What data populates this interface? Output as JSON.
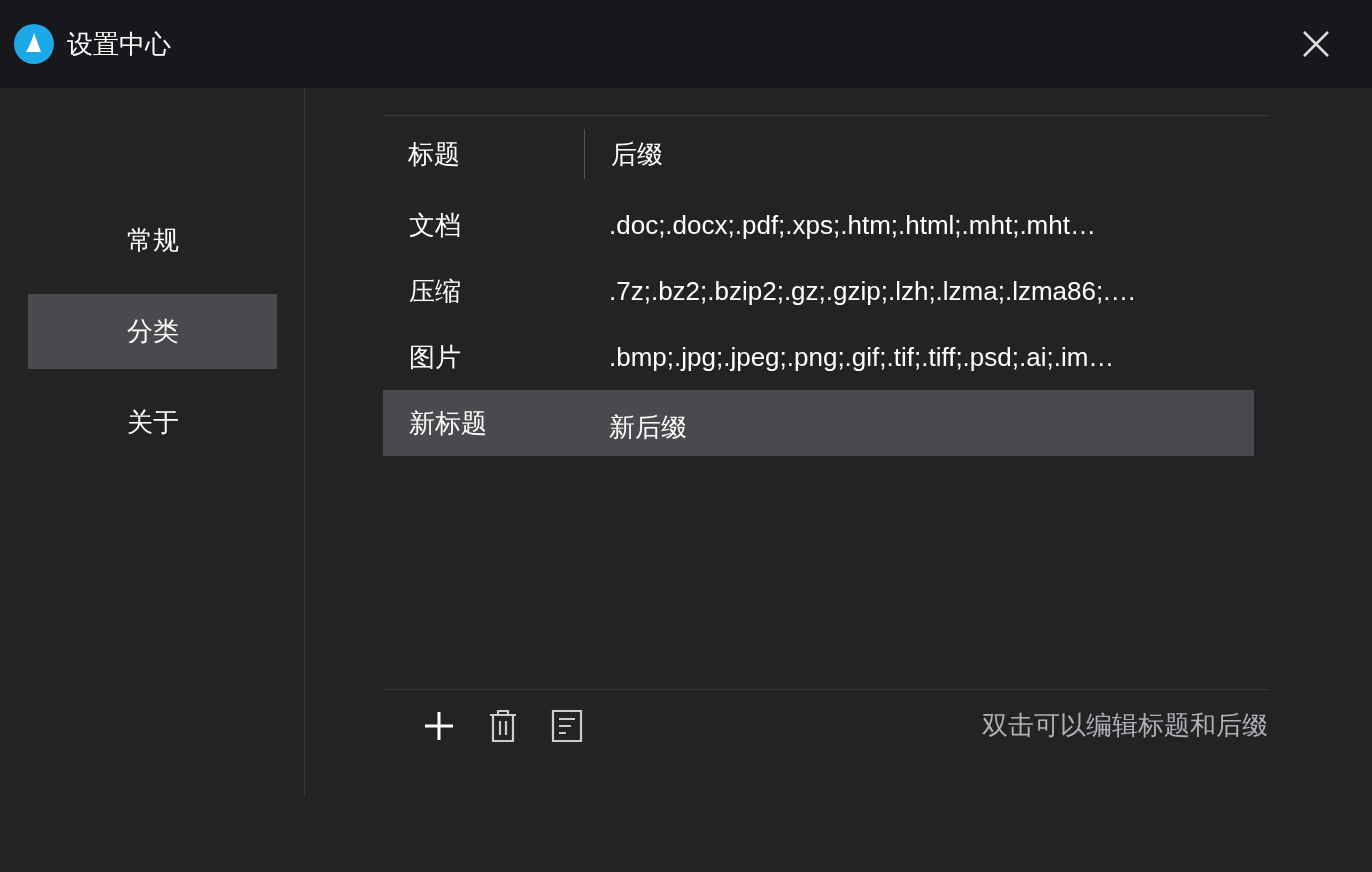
{
  "window": {
    "title": "设置中心"
  },
  "sidebar": {
    "items": [
      {
        "label": "常规",
        "selected": false
      },
      {
        "label": "分类",
        "selected": true
      },
      {
        "label": "关于",
        "selected": false
      }
    ]
  },
  "table": {
    "columns": [
      "标题",
      "后缀"
    ],
    "rows": [
      {
        "title": "文档",
        "suffix": ".doc;.docx;.pdf;.xps;.htm;.html;.mht;.mht…",
        "selected": false,
        "editing": false
      },
      {
        "title": "压缩",
        "suffix": ".7z;.bz2;.bzip2;.gz;.gzip;.lzh;.lzma;.lzma86;.…",
        "selected": false,
        "editing": false
      },
      {
        "title": "图片",
        "suffix": ".bmp;.jpg;.jpeg;.png;.gif;.tif;.tiff;.psd;.ai;.im…",
        "selected": false,
        "editing": false
      },
      {
        "title": "新标题",
        "suffix": "新后缀",
        "selected": true,
        "editing": true
      }
    ]
  },
  "footer": {
    "hint": "双击可以编辑标题和后缀"
  }
}
